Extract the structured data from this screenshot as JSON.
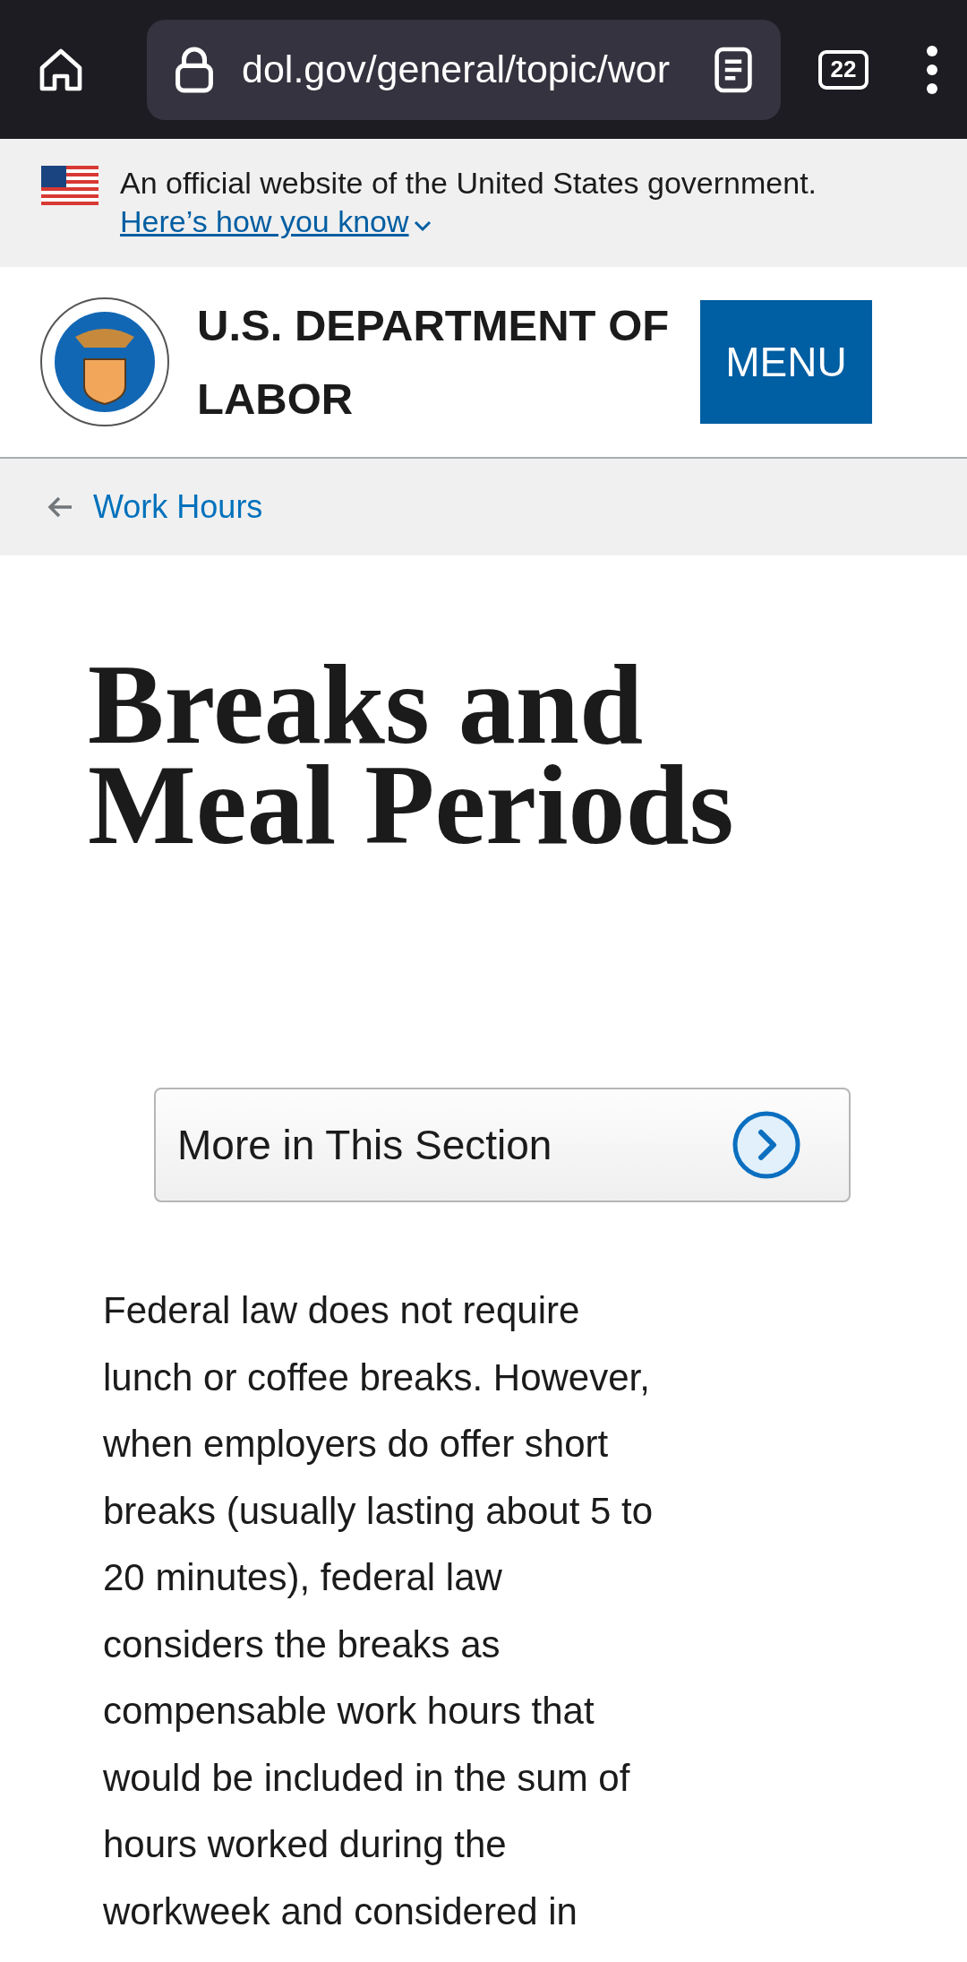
{
  "browser": {
    "url": "dol.gov/general/topic/wor",
    "tab_count": "22"
  },
  "gov_banner": {
    "text": "An official website of the United States government.",
    "link": "Here’s how you know"
  },
  "header": {
    "title_line_1": "U.S. DEPARTMENT OF",
    "title_line_2": "LABOR",
    "menu_button": "MENU"
  },
  "breadcrumb": {
    "link": "Work Hours"
  },
  "page_title": {
    "line_1": "Breaks and",
    "line_2": "Meal Periods"
  },
  "section_button": {
    "label": "More in This Section"
  },
  "body_text": "Federal law does not require lunch or coffee breaks. However, when employers do offer short breaks (usually lasting about 5 to 20 minutes), federal law considers the breaks as compensable work hours that would be included in the sum of hours worked during the workweek and considered in"
}
